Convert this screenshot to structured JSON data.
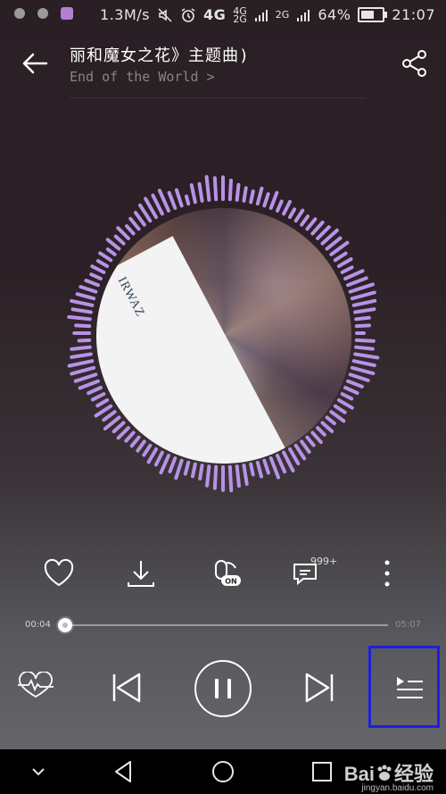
{
  "status_bar": {
    "speed": "1.3M/s",
    "network": "4G",
    "net_top": "4G",
    "net_bottom": "2G",
    "net_extra": "2G",
    "battery": "64%",
    "battery_level": 0.64,
    "time": "21:07"
  },
  "header": {
    "title": "丽和魔女之花》主题曲)",
    "subtitle": "End of the World",
    "subtitle_chevron": ">"
  },
  "cover": {
    "brand_text": "IRWAZ"
  },
  "actions": {
    "comments_badge": "999+",
    "toggle_state": "ON"
  },
  "progress": {
    "elapsed": "00:04",
    "total": "05:07",
    "fraction": 0.013
  },
  "colors": {
    "accent_purple": "#b892e6",
    "highlight_box": "#1e1ee0"
  },
  "watermark": {
    "brand": "Bai",
    "brand_tail": "经验",
    "url": "jingyan.baidu.com"
  }
}
